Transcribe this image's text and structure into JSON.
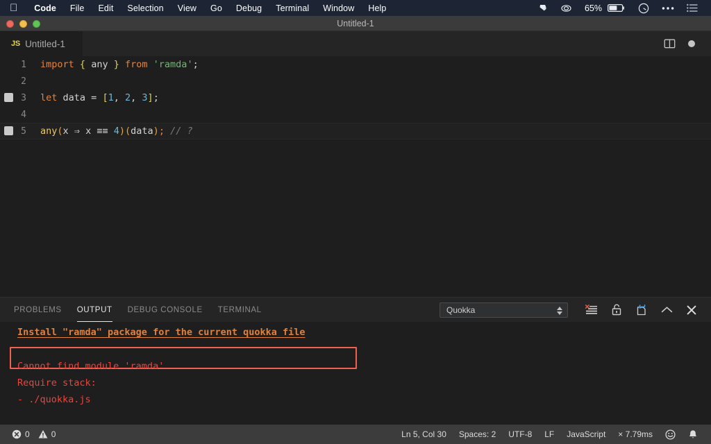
{
  "menubar": {
    "apple_icon": "apple-logo-icon",
    "items": [
      {
        "label": "Code",
        "bold": true
      },
      {
        "label": "File",
        "bold": false
      },
      {
        "label": "Edit",
        "bold": false
      },
      {
        "label": "Selection",
        "bold": false
      },
      {
        "label": "View",
        "bold": false
      },
      {
        "label": "Go",
        "bold": false
      },
      {
        "label": "Debug",
        "bold": false
      },
      {
        "label": "Terminal",
        "bold": false
      },
      {
        "label": "Window",
        "bold": false
      },
      {
        "label": "Help",
        "bold": false
      }
    ],
    "status_icons": [
      {
        "name": "dropbox-icon"
      },
      {
        "name": "cloud-sync-icon"
      },
      {
        "name": "battery-icon"
      },
      {
        "name": "time-machine-icon"
      },
      {
        "name": "control-center-icon"
      },
      {
        "name": "notification-center-icon"
      }
    ],
    "battery_percent": "65%"
  },
  "window": {
    "title": "Untitled-1",
    "traffic_lights": [
      "close-button",
      "minimize-button",
      "maximize-button"
    ]
  },
  "tabs": {
    "active": {
      "file_type_badge": "JS",
      "label": "Untitled-1"
    },
    "actions": [
      {
        "name": "split-editor-icon"
      },
      {
        "name": "unsaved-dot-icon"
      }
    ]
  },
  "editor": {
    "lines": [
      {
        "number": "1",
        "gutter_mark": false,
        "current": false,
        "tokens": [
          {
            "t": "import",
            "c": "t-kw"
          },
          {
            "t": " ",
            "c": "t-punc"
          },
          {
            "t": "{",
            "c": "t-brace"
          },
          {
            "t": " ",
            "c": "t-punc"
          },
          {
            "t": "any",
            "c": "t-id"
          },
          {
            "t": " ",
            "c": "t-punc"
          },
          {
            "t": "}",
            "c": "t-brace"
          },
          {
            "t": " ",
            "c": "t-punc"
          },
          {
            "t": "from",
            "c": "t-kw"
          },
          {
            "t": " ",
            "c": "t-punc"
          },
          {
            "t": "'ramda'",
            "c": "t-str"
          },
          {
            "t": ";",
            "c": "t-punc"
          }
        ]
      },
      {
        "number": "2",
        "gutter_mark": false,
        "current": false,
        "tokens": []
      },
      {
        "number": "3",
        "gutter_mark": true,
        "current": false,
        "tokens": [
          {
            "t": "let",
            "c": "t-kw"
          },
          {
            "t": " data ",
            "c": "t-id"
          },
          {
            "t": "=",
            "c": "t-op"
          },
          {
            "t": " ",
            "c": "t-punc"
          },
          {
            "t": "[",
            "c": "t-brace"
          },
          {
            "t": "1",
            "c": "t-num"
          },
          {
            "t": ", ",
            "c": "t-punc"
          },
          {
            "t": "2",
            "c": "t-num"
          },
          {
            "t": ", ",
            "c": "t-punc"
          },
          {
            "t": "3",
            "c": "t-num"
          },
          {
            "t": "]",
            "c": "t-brace"
          },
          {
            "t": ";",
            "c": "t-punc"
          }
        ]
      },
      {
        "number": "4",
        "gutter_mark": false,
        "current": false,
        "tokens": []
      },
      {
        "number": "5",
        "gutter_mark": true,
        "current": true,
        "tokens": [
          {
            "t": "any",
            "c": "t-fn"
          },
          {
            "t": "(",
            "c": "t-paren"
          },
          {
            "t": "x ",
            "c": "t-id"
          },
          {
            "t": "⇒",
            "c": "t-op"
          },
          {
            "t": " x ",
            "c": "t-id"
          },
          {
            "t": "≡≡",
            "c": "t-op"
          },
          {
            "t": " ",
            "c": "t-punc"
          },
          {
            "t": "4",
            "c": "t-num"
          },
          {
            "t": ")",
            "c": "t-paren"
          },
          {
            "t": "(",
            "c": "t-paren"
          },
          {
            "t": "data",
            "c": "t-id"
          },
          {
            "t": ")",
            "c": "t-paren"
          },
          {
            "t": ";",
            "c": "t-sc"
          },
          {
            "t": " ",
            "c": "t-punc"
          },
          {
            "t": "// ?",
            "c": "t-cmt"
          }
        ]
      }
    ],
    "raw_source": "import { any } from 'ramda';\n\nlet data = [1, 2, 3];\n\nany(x => x === 4)(data); // ?"
  },
  "panel": {
    "tabs": [
      {
        "label": "PROBLEMS",
        "active": false
      },
      {
        "label": "OUTPUT",
        "active": true
      },
      {
        "label": "DEBUG CONSOLE",
        "active": false
      },
      {
        "label": "TERMINAL",
        "active": false
      }
    ],
    "channel_select": {
      "value": "Quokka",
      "options": [
        "Quokka"
      ]
    },
    "actions": [
      {
        "name": "clear-output-icon"
      },
      {
        "name": "lock-scroll-icon"
      },
      {
        "name": "open-in-editor-icon"
      },
      {
        "name": "maximize-panel-icon"
      },
      {
        "name": "close-panel-icon"
      }
    ],
    "output": {
      "link": "Install \"ramda\" package for the current quokka file",
      "link_color": "#e0813c",
      "focus_border_color": "#f2614f",
      "error_color": "#e8453c",
      "error_lines": [
        "Cannot find module 'ramda'",
        "Require stack:",
        "- ./quokka.js"
      ]
    }
  },
  "statusbar": {
    "left": [
      {
        "name": "errors",
        "icon": "error-circle-icon",
        "value": "0"
      },
      {
        "name": "warnings",
        "icon": "warning-triangle-icon",
        "value": "0"
      }
    ],
    "right": [
      {
        "name": "cursor-position",
        "label": "Ln 5, Col 30"
      },
      {
        "name": "indentation",
        "label": "Spaces: 2"
      },
      {
        "name": "encoding",
        "label": "UTF-8"
      },
      {
        "name": "eol",
        "label": "LF"
      },
      {
        "name": "language-mode",
        "label": "JavaScript"
      },
      {
        "name": "quokka-timing",
        "label": "× 7.79ms"
      }
    ],
    "icons": [
      {
        "name": "feedback-smiley-icon"
      },
      {
        "name": "notifications-bell-icon"
      }
    ]
  }
}
